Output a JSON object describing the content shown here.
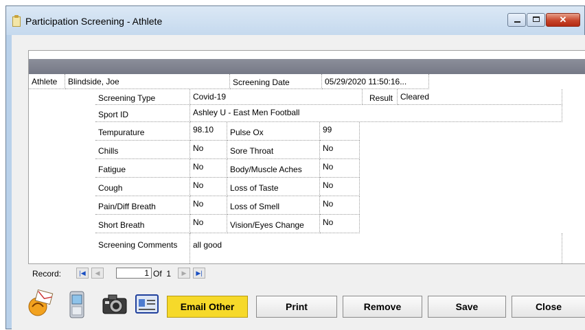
{
  "window": {
    "title": "Participation Screening - Athlete"
  },
  "form": {
    "athlete_label": "Athlete",
    "athlete_value": "Blindside, Joe",
    "screening_date_label": "Screening Date",
    "screening_date_value": "05/29/2020 11:50:16...",
    "screening_type_label": "Screening Type",
    "screening_type_value": "Covid-19",
    "result_label": "Result",
    "result_value": "Cleared",
    "sport_id_label": "Sport ID",
    "sport_id_value": "Ashley U -  East Men Football",
    "temperature_label": "Tempurature",
    "temperature_value": "98.10",
    "pulse_ox_label": "Pulse Ox",
    "pulse_ox_value": "99",
    "chills_label": "Chills",
    "chills_value": "No",
    "sore_throat_label": "Sore Throat",
    "sore_throat_value": "No",
    "fatigue_label": "Fatigue",
    "fatigue_value": "No",
    "aches_label": "Body/Muscle Aches",
    "aches_value": "No",
    "cough_label": "Cough",
    "cough_value": "No",
    "taste_label": "Loss of Taste",
    "taste_value": "No",
    "pain_label": "Pain/Diff Breath",
    "pain_value": "No",
    "smell_label": "Loss of Smell",
    "smell_value": "No",
    "short_breath_label": "Short Breath",
    "short_breath_value": "No",
    "vision_label": "Vision/Eyes Change",
    "vision_value": "No",
    "comments_label": "Screening Comments",
    "comments_value": "all good"
  },
  "navigator": {
    "record_label": "Record:",
    "current": "1",
    "of_label": "Of",
    "total": "1"
  },
  "buttons": {
    "email_other": "Email Other",
    "print": "Print",
    "remove": "Remove",
    "save": "Save",
    "close": "Close"
  },
  "colors": {
    "email_button": "#f6d92a",
    "header_bar": "#7f8290",
    "window_frame": "#b9d1ea"
  },
  "icons": [
    "email-icon",
    "mobile-phone-icon",
    "camera-icon",
    "id-card-icon"
  ]
}
